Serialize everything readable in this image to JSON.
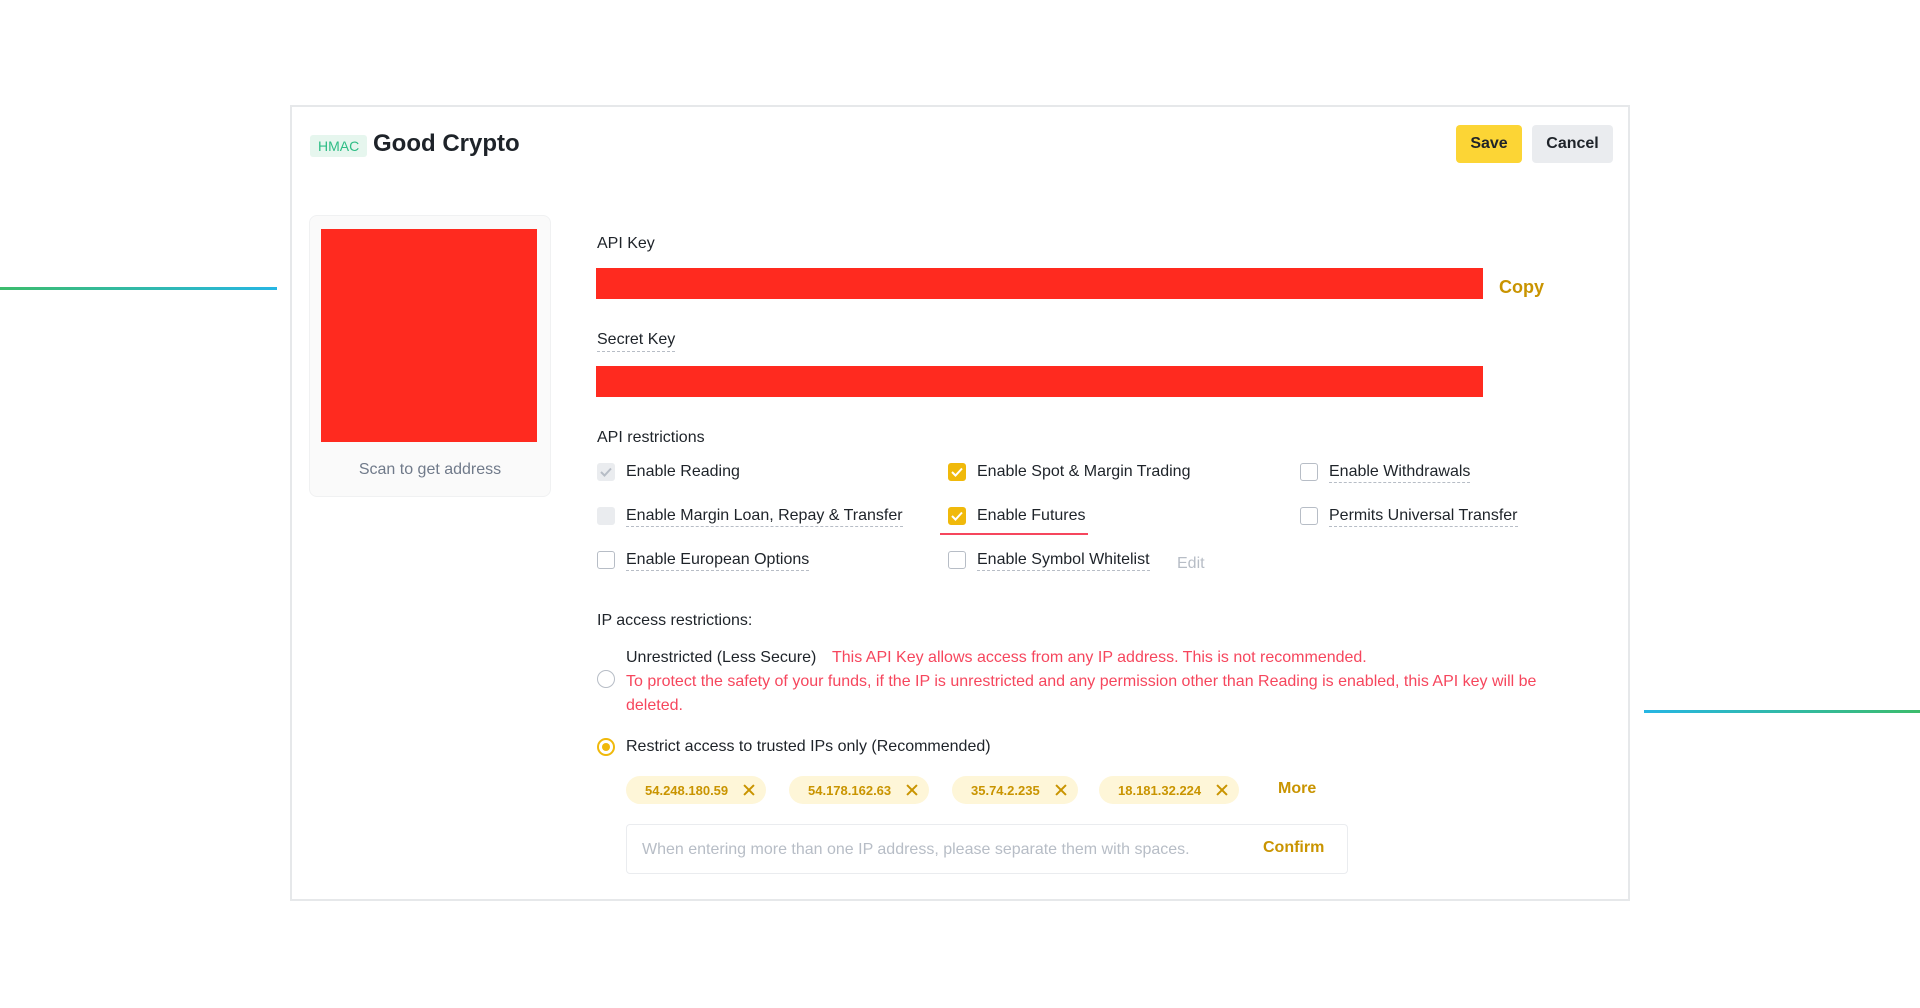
{
  "header": {
    "badge": "HMAC",
    "title": "Good Crypto",
    "save_label": "Save",
    "cancel_label": "Cancel"
  },
  "qr": {
    "caption": "Scan to get address"
  },
  "api_key": {
    "label": "API Key",
    "copy_label": "Copy"
  },
  "secret_key": {
    "label": "Secret Key"
  },
  "restrictions": {
    "title": "API restrictions",
    "items": [
      {
        "label": "Enable Reading",
        "state": "checked-disabled"
      },
      {
        "label": "Enable Spot & Margin Trading",
        "state": "checked"
      },
      {
        "label": "Enable Withdrawals",
        "state": "unchecked"
      },
      {
        "label": "Enable Margin Loan, Repay & Transfer",
        "state": "disabled"
      },
      {
        "label": "Enable Futures",
        "state": "checked"
      },
      {
        "label": "Permits Universal Transfer",
        "state": "unchecked"
      },
      {
        "label": "Enable European Options",
        "state": "unchecked"
      },
      {
        "label": "Enable Symbol Whitelist",
        "state": "unchecked"
      }
    ],
    "edit_label": "Edit"
  },
  "ip_access": {
    "title": "IP access restrictions:",
    "unrestricted_label": "Unrestricted (Less Secure)",
    "unrestricted_warning": "This API Key allows access from any IP address. This is not recommended.",
    "unrestricted_warning_line2": "To protect the safety of your funds, if the IP is unrestricted and any permission other than Reading is enabled, this API key will be",
    "unrestricted_warning_line3": "deleted.",
    "restricted_label": "Restrict access to trusted IPs only (Recommended)",
    "selected": "restricted",
    "ips": [
      "54.248.180.59",
      "54.178.162.63",
      "35.74.2.235",
      "18.181.32.224"
    ],
    "more_label": "More",
    "input_placeholder": "When entering more than one IP address, please separate them with spaces.",
    "confirm_label": "Confirm"
  },
  "colors": {
    "accent": "#fcd535",
    "link": "#c99400",
    "warning": "#f6465d",
    "redaction": "#ff2a1f"
  }
}
